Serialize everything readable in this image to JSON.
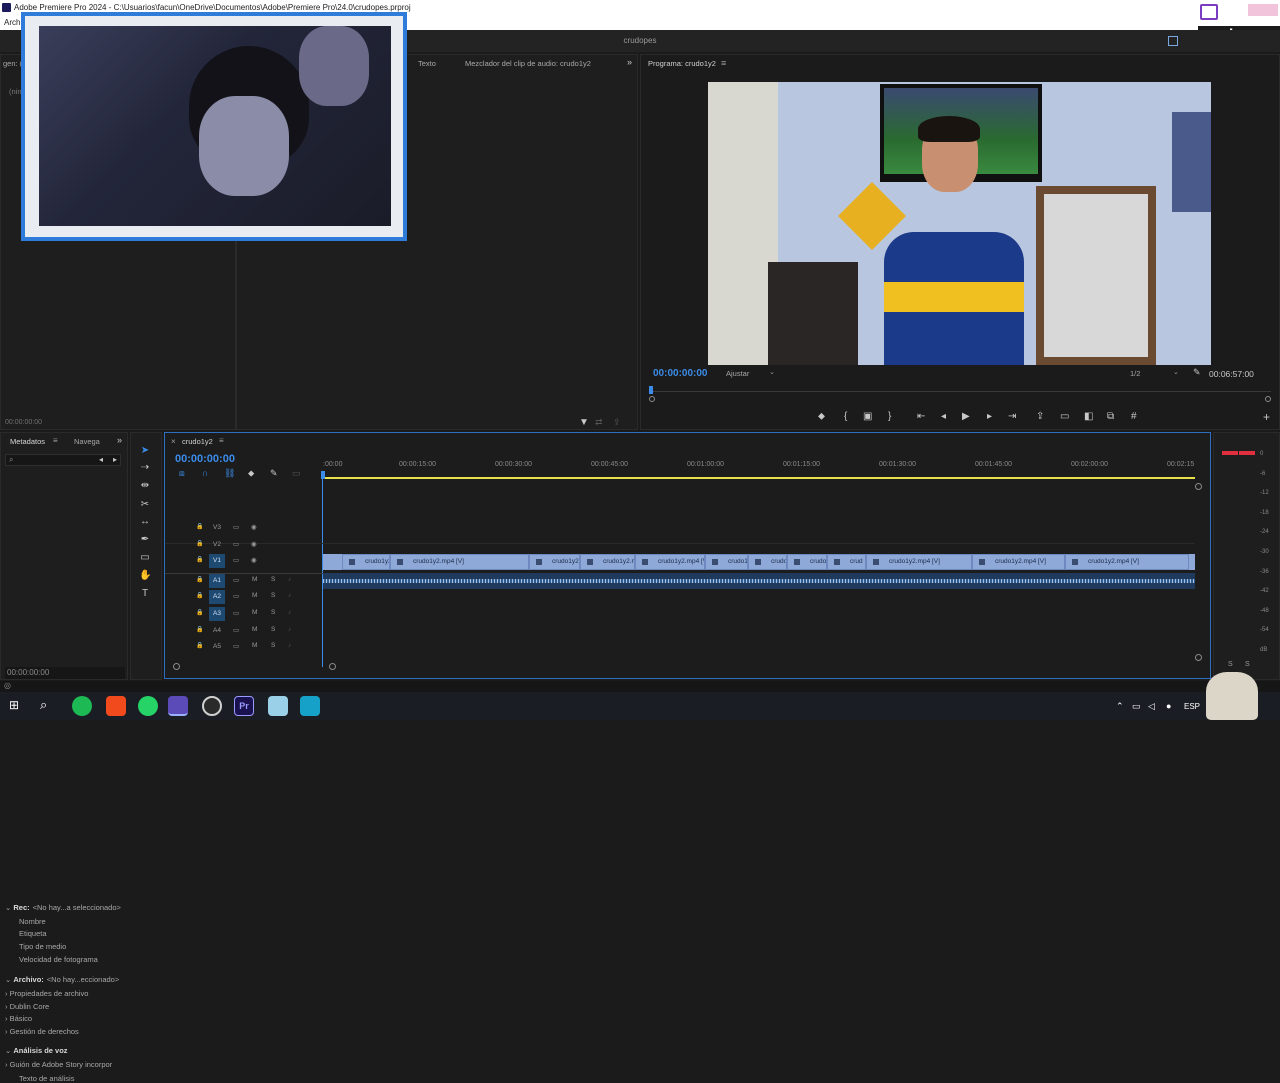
{
  "window": {
    "title": "Adobe Premiere Pro 2024 - C:\\Usuarios\\facun\\OneDrive\\Documentos\\Adobe\\Premiere Pro\\24.0\\crudopes.prproj",
    "menu_first": "Arch",
    "project_name": "crudopes"
  },
  "source_panel": {
    "tab_partial": "gen: (",
    "label_partial": "(nin",
    "timecode": "00:00:00:00",
    "tab_texto": "Texto",
    "tab_mixer": "Mezclador del clip de audio: crudo1y2"
  },
  "program": {
    "tab": "Programa: crudo1y2",
    "timecode_current": "00:00:00:00",
    "fit": "Ajustar",
    "resolution": "1/2",
    "duration": "00:06:57:00"
  },
  "metadata_panel": {
    "tab_metadata": "Metadatos",
    "tab_nav": "Navega",
    "rows": [
      {
        "label": "Rec:",
        "value": "<No hay...a seleccionado>",
        "bold": true
      },
      {
        "label": "Nombre"
      },
      {
        "label": "Etiqueta"
      },
      {
        "label": "Tipo de medio"
      },
      {
        "label": "Velocidad de fotograma"
      },
      {
        "label": "Archivo:",
        "value": "<No hay...eccionado>",
        "bold": true
      },
      {
        "label": "Propiedades de archivo",
        "chev": true
      },
      {
        "label": "Dublin Core",
        "chev": true
      },
      {
        "label": "Básico",
        "chev": true
      },
      {
        "label": "Gestión de derechos",
        "chev": true
      },
      {
        "label": "Análisis de voz",
        "bold": true
      },
      {
        "label": "Guión de Adobe Story incorpor",
        "chev": true
      },
      {
        "label": "Texto de análisis"
      }
    ],
    "timecode": "00:00:00:00"
  },
  "timeline": {
    "tab": "crudo1y2",
    "timecode": "00:00:00:00",
    "ruler": [
      ":00:00",
      "00:00:15:00",
      "00:00:30:00",
      "00:00:45:00",
      "00:01:00:00",
      "00:01:15:00",
      "00:01:30:00",
      "00:01:45:00",
      "00:02:00:00",
      "00:02:15"
    ],
    "tracks": [
      {
        "name": "V3"
      },
      {
        "name": "V2"
      },
      {
        "name": "V1",
        "active": true
      },
      {
        "name": "A1",
        "active": true
      },
      {
        "name": "A2",
        "active": true
      },
      {
        "name": "A3",
        "active": true
      },
      {
        "name": "A4"
      },
      {
        "name": "A5"
      }
    ],
    "track_m": "M",
    "track_s": "S",
    "clips": [
      "crudo1y2.",
      "crudo1y2.mp4 [V]",
      "crudo1y2.",
      "crudo1y2.m",
      "crudo1y2.mp4 [V]",
      "crudo1",
      "crudo1",
      "crudo",
      "crud",
      "crudo1y2.mp4 [V]",
      "crudo1y2.mp4 [V]",
      "crudo1y2.mp4 [V]"
    ]
  },
  "meter": {
    "scale": [
      "0",
      "-6",
      "-12",
      "-18",
      "-24",
      "-30",
      "-36",
      "-42",
      "-48",
      "-54",
      "dB"
    ],
    "solo": [
      "S",
      "S"
    ]
  },
  "taskbar": {
    "lang": "ESP"
  },
  "colors": {
    "accent_blue": "#3b8ce8",
    "clip_blue": "#8ea8d8",
    "webcam_border": "#2e7bd9",
    "meter_red": "#e03040",
    "playhead_yellow": "#e8e04a"
  }
}
